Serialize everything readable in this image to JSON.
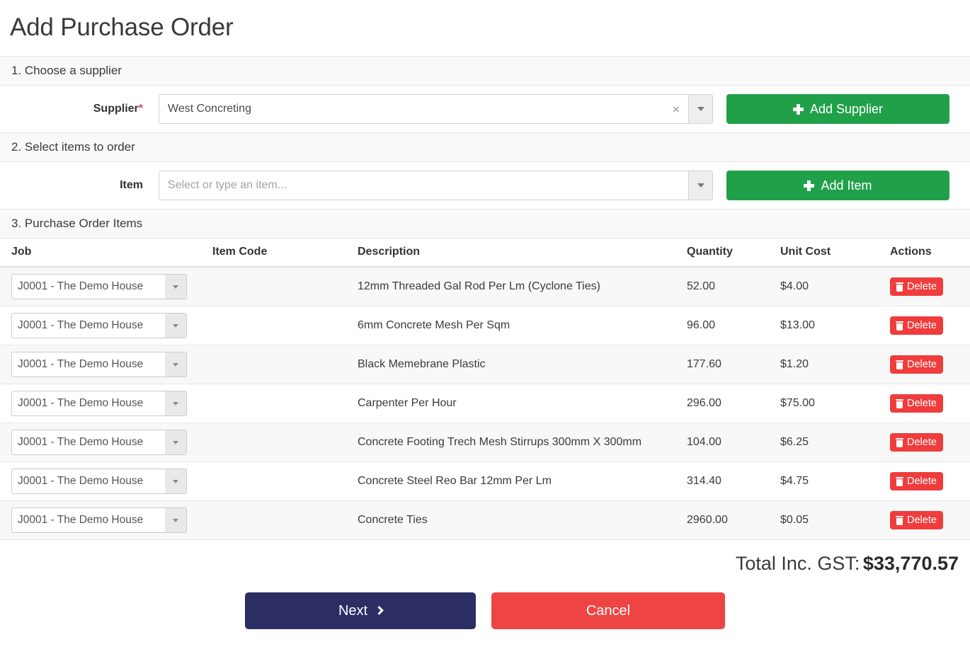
{
  "page": {
    "title": "Add Purchase Order"
  },
  "sections": {
    "supplier": {
      "heading": "1. Choose a supplier",
      "label": "Supplier",
      "required_mark": "*",
      "value": "West Concreting",
      "clear_icon": "×",
      "add_button": "Add Supplier"
    },
    "items": {
      "heading": "2. Select items to order",
      "label": "Item",
      "value": "",
      "placeholder": "Select or type an item...",
      "add_button": "Add Item"
    },
    "order_items": {
      "heading": "3. Purchase Order Items",
      "columns": [
        "Job",
        "Item Code",
        "Description",
        "Quantity",
        "Unit Cost",
        "Actions"
      ],
      "delete_label": "Delete",
      "rows": [
        {
          "job": "J0001 - The Demo House",
          "item_code": "",
          "description": "12mm Threaded Gal Rod Per Lm (Cyclone Ties)",
          "quantity": "52.00",
          "unit_cost": "$4.00"
        },
        {
          "job": "J0001 - The Demo House",
          "item_code": "",
          "description": "6mm Concrete Mesh Per Sqm",
          "quantity": "96.00",
          "unit_cost": "$13.00"
        },
        {
          "job": "J0001 - The Demo House",
          "item_code": "",
          "description": "Black Memebrane Plastic",
          "quantity": "177.60",
          "unit_cost": "$1.20"
        },
        {
          "job": "J0001 - The Demo House",
          "item_code": "",
          "description": "Carpenter Per Hour",
          "quantity": "296.00",
          "unit_cost": "$75.00"
        },
        {
          "job": "J0001 - The Demo House",
          "item_code": "",
          "description": "Concrete Footing Trech Mesh Stirrups 300mm X 300mm",
          "quantity": "104.00",
          "unit_cost": "$6.25"
        },
        {
          "job": "J0001 - The Demo House",
          "item_code": "",
          "description": "Concrete Steel Reo Bar 12mm Per Lm",
          "quantity": "314.40",
          "unit_cost": "$4.75"
        },
        {
          "job": "J0001 - The Demo House",
          "item_code": "",
          "description": "Concrete Ties",
          "quantity": "2960.00",
          "unit_cost": "$0.05"
        }
      ]
    }
  },
  "total": {
    "label": "Total Inc. GST:",
    "value": "$33,770.57"
  },
  "footer": {
    "next_label": "Next",
    "cancel_label": "Cancel"
  },
  "colors": {
    "green": "#21a04a",
    "red": "#f03c3c",
    "navy": "#2b2d63",
    "cancel_red": "#ef4444",
    "required": "#e24a4a"
  }
}
